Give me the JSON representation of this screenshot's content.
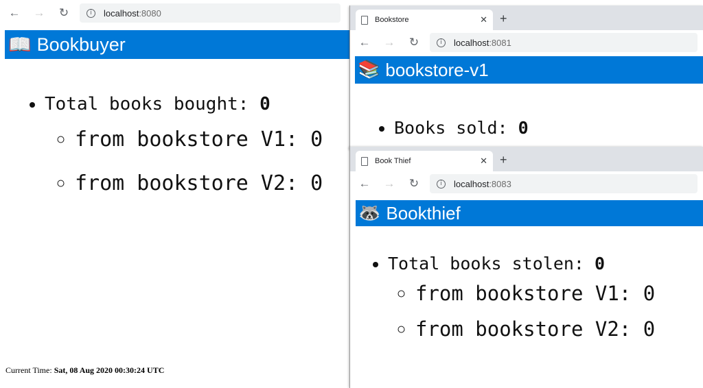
{
  "buyer": {
    "url_host": "localhost",
    "url_port": ":8080",
    "header_icon": "📖",
    "header_title": "Bookbuyer",
    "total_label": "Total books bought: ",
    "total_value": "0",
    "v1_label": "from bookstore V1: ",
    "v1_value": "0",
    "v2_label": "from bookstore V2: ",
    "v2_value": "0",
    "time_label": "Current Time: ",
    "time_value": "Sat, 08 Aug 2020 00:30:24 UTC"
  },
  "store": {
    "tab_title": "Bookstore",
    "url_host": "localhost",
    "url_port": ":8081",
    "header_icon": "📚",
    "header_title": "bookstore-v1",
    "sold_label": "Books sold: ",
    "sold_value": "0"
  },
  "thief": {
    "tab_title": "Book Thief",
    "url_host": "localhost",
    "url_port": ":8083",
    "header_icon": "🦝",
    "header_title": "Bookthief",
    "total_label": "Total books stolen: ",
    "total_value": "0",
    "v1_label": "from bookstore V1: ",
    "v1_value": "0",
    "v2_label": "from bookstore V2: ",
    "v2_value": "0"
  },
  "browser": {
    "back_icon": "←",
    "forward_icon": "→",
    "reload_icon": "↻",
    "info_icon": "i",
    "close_icon": "✕",
    "new_tab_icon": "+",
    "header_color": "#0078d7"
  }
}
